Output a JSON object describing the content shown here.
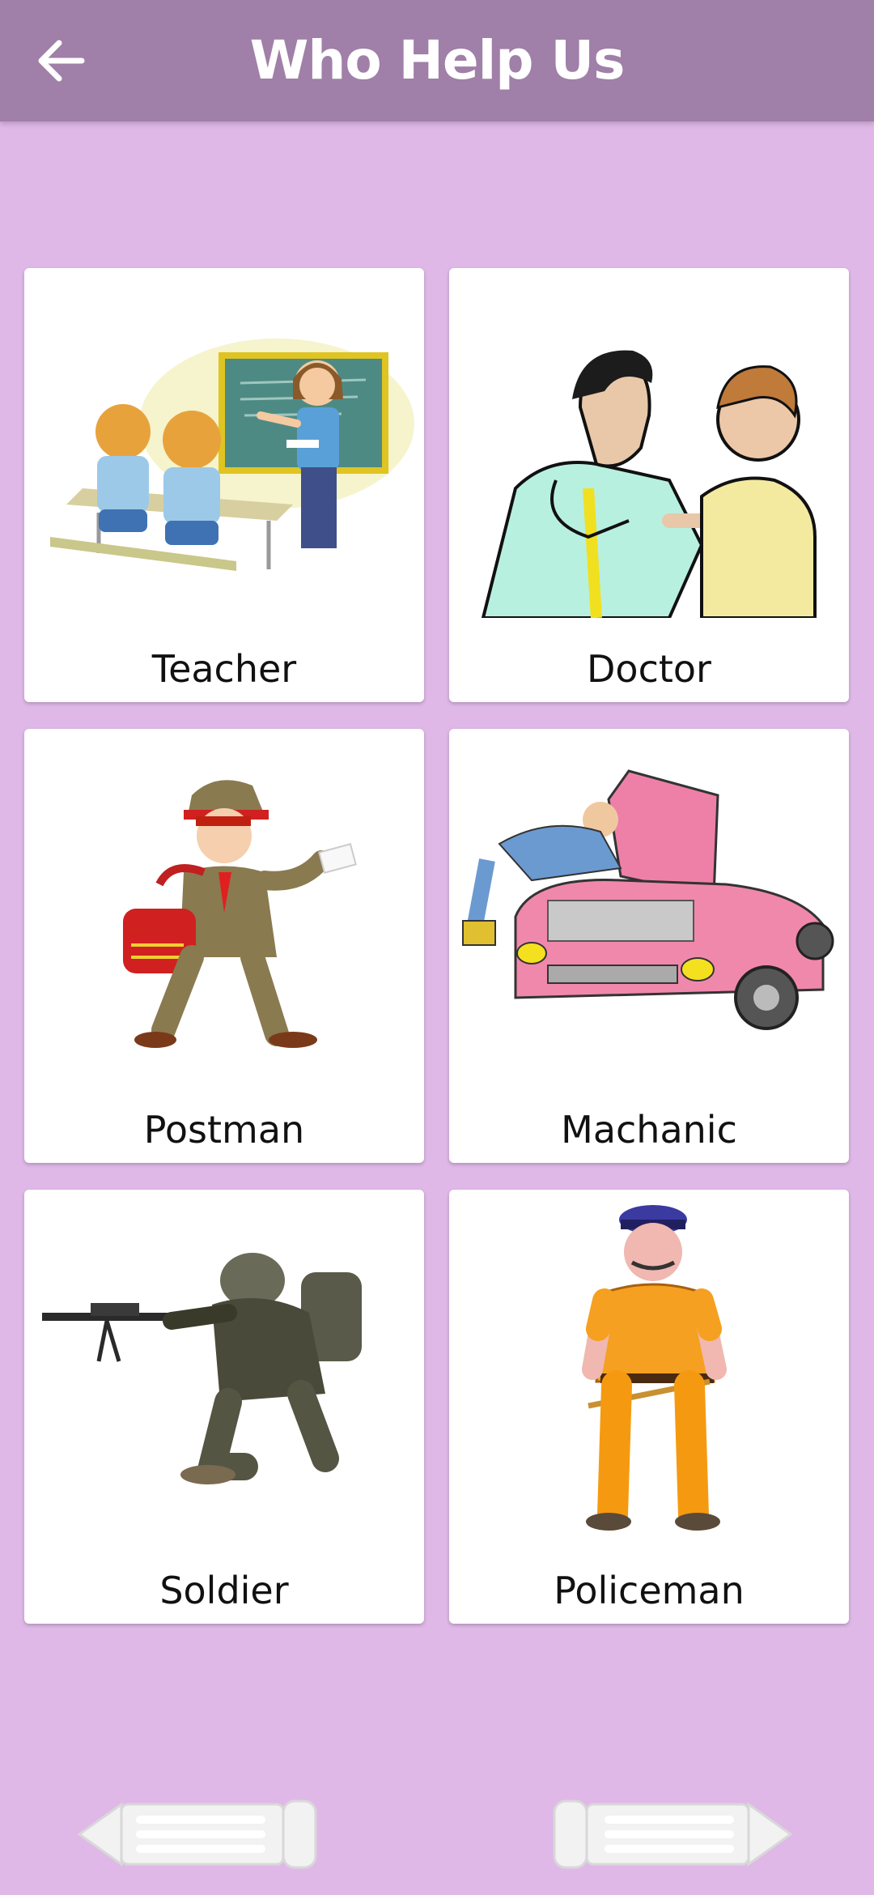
{
  "app_bar": {
    "title": "Who Help Us",
    "back_icon": "arrow-left-icon"
  },
  "cards": [
    {
      "label": "Teacher",
      "icon": "teacher-illustration"
    },
    {
      "label": "Doctor",
      "icon": "doctor-illustration"
    },
    {
      "label": "Postman",
      "icon": "postman-illustration"
    },
    {
      "label": "Machanic",
      "icon": "mechanic-illustration"
    },
    {
      "label": "Soldier",
      "icon": "soldier-illustration"
    },
    {
      "label": "Policeman",
      "icon": "policeman-illustration"
    }
  ],
  "nav": {
    "prev_icon": "pencil-arrow-left-icon",
    "next_icon": "pencil-arrow-right-icon"
  },
  "colors": {
    "background": "#dfb8e8",
    "app_bar": "#a07fa8",
    "card": "#ffffff",
    "title_text": "#ffffff"
  }
}
